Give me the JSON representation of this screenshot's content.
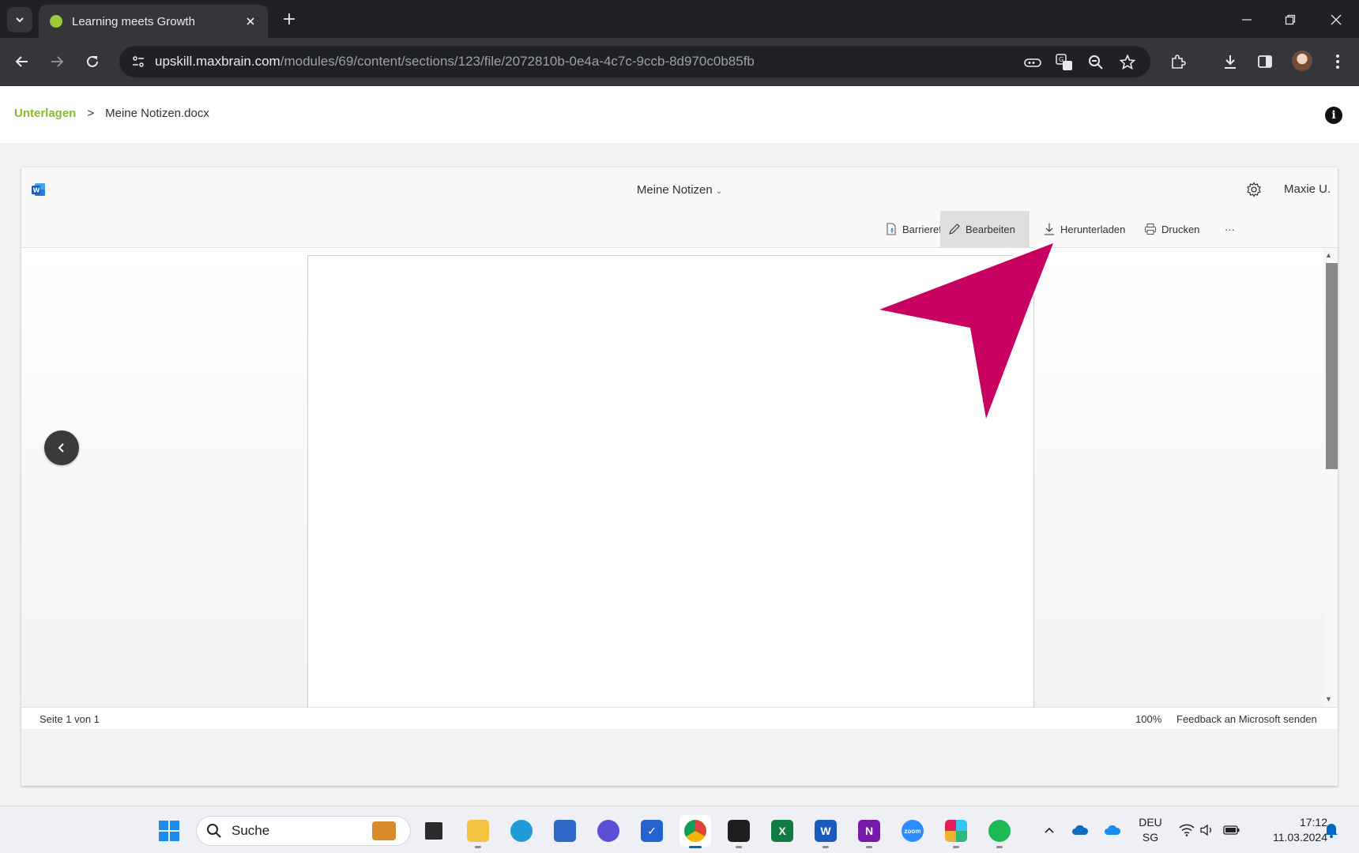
{
  "browser": {
    "tab_title": "Learning meets Growth",
    "url_host": "upskill.maxbrain.com",
    "url_path": "/modules/69/content/sections/123/file/2072810b-0e4a-4c7c-9ccb-8d970c0b85fb"
  },
  "breadcrumb": {
    "parent": "Unterlagen",
    "separator": ">",
    "current": "Meine Notizen.docx"
  },
  "viewer": {
    "doc_title": "Meine Notizen",
    "user": "Maxie U.",
    "commands": {
      "accessibility": "Barrierefreiheitsmodus",
      "edit": "Bearbeiten",
      "download": "Herunterladen",
      "print": "Drucken",
      "more": "···"
    },
    "status": {
      "page": "Seite 1 von 1",
      "zoom": "100%",
      "feedback": "Feedback an Microsoft senden"
    }
  },
  "taskbar": {
    "search_placeholder": "Suche",
    "lang_primary": "DEU",
    "lang_secondary": "SG",
    "time": "17:12",
    "date": "11.03.2024"
  },
  "colors": {
    "accent_green": "#8db82b",
    "annotation_magenta": "#c8005f",
    "word_blue": "#185abd"
  },
  "icons": [
    "tab-search-icon",
    "close-icon",
    "plus-icon",
    "minimize-icon",
    "restore-icon",
    "back-icon",
    "forward-icon",
    "reload-icon",
    "site-info-icon",
    "key-icon",
    "translate-icon",
    "zoom-icon",
    "star-icon",
    "extensions-icon",
    "download-icon",
    "sidepanel-icon",
    "kebab-icon",
    "info-icon",
    "word-icon",
    "gear-icon",
    "pencil-icon",
    "print-icon",
    "chevron-left-icon",
    "windows-start-icon",
    "search-icon"
  ]
}
